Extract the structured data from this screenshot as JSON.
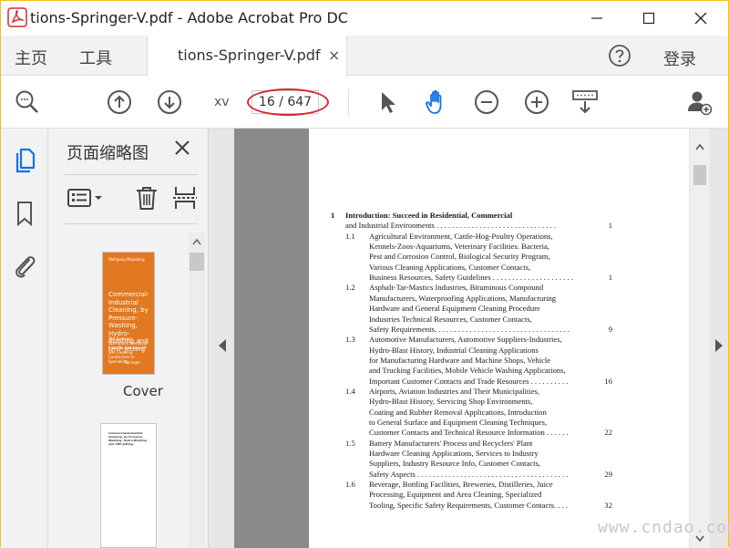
{
  "window": {
    "title": "tions-Springer-V.pdf - Adobe Acrobat Pro DC",
    "controls": [
      "minimize-icon",
      "maximize-icon",
      "close-icon"
    ]
  },
  "menubar": {
    "home": "主页",
    "tools": "工具",
    "tab_label": "tions-Springer-V.pdf",
    "tab_close": "×",
    "login": "登录"
  },
  "toolbar": {
    "page_label": "xv",
    "page_indicator": "16 / 647",
    "icons": [
      "zoom-search-icon",
      "previous-page-icon",
      "next-page-icon",
      "select-cursor-icon",
      "hand-tool-icon",
      "zoom-out-icon",
      "zoom-in-icon",
      "keyboard-scroll-icon",
      "add-user-icon"
    ]
  },
  "thumbnails": {
    "title": "页面缩略图",
    "cover_caption": "Cover",
    "cover": {
      "author": "Wolfgang Maasberg",
      "title": "Commercial-Industrial Cleaning, by Pressure-Washing, Hydro-Blasting and UHP-Jetting",
      "subtitle": "The Business Operations Handbook from On-Site and Off-Site Cleaning Contractors to Specialists",
      "publisher": "Springer"
    },
    "page2_text": "Commercial-Industrial Cleaning, by Pressure-Washing, Hydro-Blasting and UHP-Jetting"
  },
  "toc": {
    "chapter": {
      "number": "1",
      "title_line1": "Introduction: Succeed in Residential, Commercial",
      "title_line2": "and Industrial Environments . . . . . . . . . . . . . . . . . . . . . . . . . . . . . . .",
      "page": "1"
    },
    "sections": [
      {
        "num": "1.1",
        "lines": [
          "Agricultural Environment, Cattle-Hog-Poultry Operations,",
          "Kennels-Zoos-Aquariums, Veterinary Facilities. Bacteria,",
          "Pest and Corrosion Control, Biological Security Program,",
          "Various Cleaning Applications, Customer Contacts,",
          "Business Resources, Safety Guidelines . . . . . . . . . . . . . . . . . . . . ."
        ],
        "page": "1"
      },
      {
        "num": "1.2",
        "lines": [
          "Asphalt-Tar-Mastics Industries, Bituminous Compound",
          "Manufacturers, Waterproofing Applications, Manufacturing",
          "Hardware and General Equipment Cleaning Procedure",
          "Industries Technical Resources, Customer Contacts,",
          "Safety Requirements. . . . . . . . . . . . . . . . . . . . . . . . . . . . . . . . . . ."
        ],
        "page": "9"
      },
      {
        "num": "1.3",
        "lines": [
          "Automotive Manufacturers, Automotive Suppliers-Industries,",
          "Hydro-Blast History, Industrial Cleaning Applications",
          "for Manufacturing Hardware and Machine Shops, Vehicle",
          "and Trucking Facilities, Mobile Vehicle Washing Applications,",
          "Important Customer Contacts and Trade Resources . . . . . . . . . ."
        ],
        "page": "16"
      },
      {
        "num": "1.4",
        "lines": [
          "Airports, Aviation Industries and Their Municipalities,",
          "Hydro-Blast History, Servicing Shop Environments,",
          "Coating and Rubber Removal Applications, Introduction",
          "to General Surface and Equipment Cleaning Techniques,",
          "Customer Contacts and Technical Resource Information . . . . . ."
        ],
        "page": "22"
      },
      {
        "num": "1.5",
        "lines": [
          "Battery Manufacturers' Process and Recyclers' Plant",
          "Hardware Cleaning Applications, Services to Industry",
          "Suppliers, Industry Resource Info, Customer Contacts,",
          "Safety Aspects . . . . . . . . . . . . . . . . . . . . . . . . . . . . . . . . . . . . . . ."
        ],
        "page": "29"
      },
      {
        "num": "1.6",
        "lines": [
          "Beverage, Bottling Facilities, Breweries, Distilleries, Juice",
          "Processing, Equipment and Area Cleaning, Specialized",
          "Tooling, Specific Safety Requirements, Customer Contacts. . . ."
        ],
        "page": "32"
      }
    ]
  },
  "watermark": "www.cndao.com",
  "colors": {
    "accent_blue": "#1473e6",
    "highlight_red": "#d9272e",
    "cover_orange": "#e2781f"
  }
}
